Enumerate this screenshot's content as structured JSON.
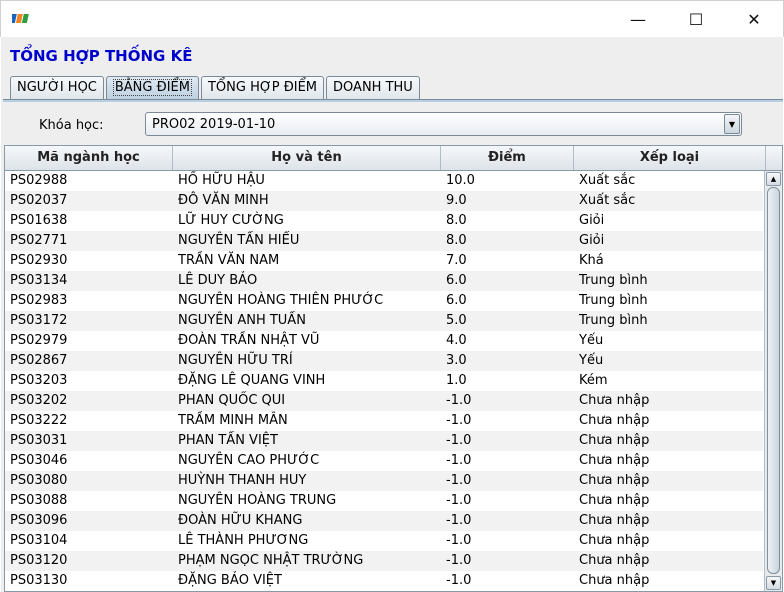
{
  "window": {
    "minimize_glyph": "—",
    "maximize_glyph": "☐",
    "close_glyph": "✕"
  },
  "app": {
    "heading": "TỔNG HỢP THỐNG KÊ",
    "brand_colors": {
      "heading": "#0000cc",
      "logo_blue": "#1565c0",
      "logo_orange": "#f58220",
      "logo_green": "#2e9e3f"
    }
  },
  "tabs": [
    {
      "label": "NGƯỜI HỌC",
      "active": false
    },
    {
      "label": "BẢNG ĐIỂM",
      "active": true
    },
    {
      "label": "TỔNG HỢP ĐIỂM",
      "active": false
    },
    {
      "label": "DOANH THU",
      "active": false
    }
  ],
  "filter": {
    "label": "Khóa học:",
    "selected": "PRO02 2019-01-10"
  },
  "table": {
    "columns": [
      "Mã ngành học",
      "Họ và tên",
      "Điểm",
      "Xếp loại"
    ],
    "rows": [
      [
        "PS02988",
        "HỒ HỮU HẬU",
        "10.0",
        "Xuất sắc"
      ],
      [
        "PS02037",
        "ĐỖ VĂN MINH",
        "9.0",
        "Xuất sắc"
      ],
      [
        "PS01638",
        "LỮ HUY CƯỜNG",
        "8.0",
        "Giỏi"
      ],
      [
        "PS02771",
        "NGUYỄN TẤN HIẾU",
        "8.0",
        "Giỏi"
      ],
      [
        "PS02930",
        "TRẦN VĂN NAM",
        "7.0",
        "Khá"
      ],
      [
        "PS03134",
        "LÊ DUY BẢO",
        "6.0",
        "Trung bình"
      ],
      [
        "PS02983",
        "NGUYỄN HOÀNG THIÊN PHƯỚC",
        "6.0",
        "Trung bình"
      ],
      [
        "PS03172",
        "NGUYỄN ANH TUẤN",
        "5.0",
        "Trung bình"
      ],
      [
        "PS02979",
        "ĐOÀN TRẦN NHẬT VŨ",
        "4.0",
        "Yếu"
      ],
      [
        "PS02867",
        "NGUYỄN HỮU TRÍ",
        "3.0",
        "Yếu"
      ],
      [
        "PS03203",
        "ĐẶNG LÊ QUANG VINH",
        "1.0",
        "Kém"
      ],
      [
        "PS03202",
        "PHAN QUỐC QUI",
        "-1.0",
        "Chưa nhập"
      ],
      [
        "PS03222",
        "TRẦM MINH MẪN",
        "-1.0",
        "Chưa nhập"
      ],
      [
        "PS03031",
        "PHAN TẤN VIỆT",
        "-1.0",
        "Chưa nhập"
      ],
      [
        "PS03046",
        "NGUYỄN CAO PHƯỚC",
        "-1.0",
        "Chưa nhập"
      ],
      [
        "PS03080",
        "HUỲNH THANH HUY",
        "-1.0",
        "Chưa nhập"
      ],
      [
        "PS03088",
        "NGUYỄN HOÀNG TRUNG",
        "-1.0",
        "Chưa nhập"
      ],
      [
        "PS03096",
        "ĐOÀN HỮU KHANG",
        "-1.0",
        "Chưa nhập"
      ],
      [
        "PS03104",
        "LÊ THÀNH PHƯƠNG",
        "-1.0",
        "Chưa nhập"
      ],
      [
        "PS03120",
        "PHẠM NGỌC NHẬT TRƯỜNG",
        "-1.0",
        "Chưa nhập"
      ],
      [
        "PS03130",
        "ĐẶNG BẢO VIỆT",
        "-1.0",
        "Chưa nhập"
      ]
    ]
  },
  "scrollbar": {
    "up_glyph": "▲",
    "down_glyph": "▼"
  },
  "combo_arrow_glyph": "▼"
}
